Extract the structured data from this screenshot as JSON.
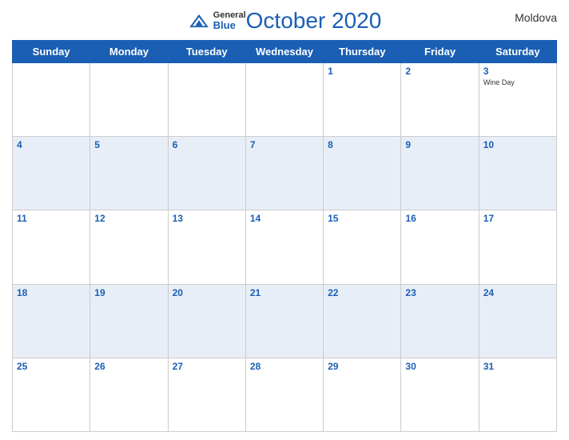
{
  "header": {
    "title": "October 2020",
    "country": "Moldova",
    "logo": {
      "general": "General",
      "blue": "Blue"
    }
  },
  "weekdays": [
    "Sunday",
    "Monday",
    "Tuesday",
    "Wednesday",
    "Thursday",
    "Friday",
    "Saturday"
  ],
  "weeks": [
    [
      {
        "day": "",
        "empty": true
      },
      {
        "day": "",
        "empty": true
      },
      {
        "day": "",
        "empty": true
      },
      {
        "day": "",
        "empty": true
      },
      {
        "day": "1",
        "event": ""
      },
      {
        "day": "2",
        "event": ""
      },
      {
        "day": "3",
        "event": "Wine Day"
      }
    ],
    [
      {
        "day": "4",
        "event": ""
      },
      {
        "day": "5",
        "event": ""
      },
      {
        "day": "6",
        "event": ""
      },
      {
        "day": "7",
        "event": ""
      },
      {
        "day": "8",
        "event": ""
      },
      {
        "day": "9",
        "event": ""
      },
      {
        "day": "10",
        "event": ""
      }
    ],
    [
      {
        "day": "11",
        "event": ""
      },
      {
        "day": "12",
        "event": ""
      },
      {
        "day": "13",
        "event": ""
      },
      {
        "day": "14",
        "event": ""
      },
      {
        "day": "15",
        "event": ""
      },
      {
        "day": "16",
        "event": ""
      },
      {
        "day": "17",
        "event": ""
      }
    ],
    [
      {
        "day": "18",
        "event": ""
      },
      {
        "day": "19",
        "event": ""
      },
      {
        "day": "20",
        "event": ""
      },
      {
        "day": "21",
        "event": ""
      },
      {
        "day": "22",
        "event": ""
      },
      {
        "day": "23",
        "event": ""
      },
      {
        "day": "24",
        "event": ""
      }
    ],
    [
      {
        "day": "25",
        "event": ""
      },
      {
        "day": "26",
        "event": ""
      },
      {
        "day": "27",
        "event": ""
      },
      {
        "day": "28",
        "event": ""
      },
      {
        "day": "29",
        "event": ""
      },
      {
        "day": "30",
        "event": ""
      },
      {
        "day": "31",
        "event": ""
      }
    ]
  ]
}
